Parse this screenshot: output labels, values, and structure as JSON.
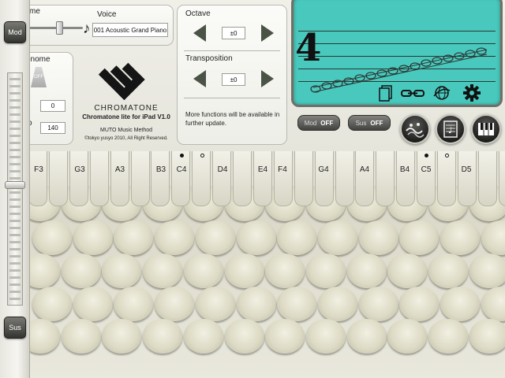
{
  "voice_panel": {
    "name_label": "me",
    "voice_label": "Voice",
    "voice_value": "001 Acoustic Grand Piano",
    "note_icon": "music-note-icon"
  },
  "metronome_panel": {
    "title": "onome",
    "switch_text": "OFF",
    "value1": "0",
    "value2": "140",
    "label_fragment": "o",
    "label_fragment2": ")"
  },
  "logo": {
    "brand": "CHROMATONE",
    "version_line": "Chromatone lite for iPad V1.0",
    "company": "MUTO Music Method",
    "copyright": "©tokyo yusyo 2010, All Right Reserved."
  },
  "octave_panel": {
    "octave_label": "Octave",
    "octave_value": "±0",
    "transposition_label": "Transposition",
    "transposition_value": "±0",
    "info_text": "More functions will be available in further update."
  },
  "lcd": {
    "digit": "4",
    "icons": [
      "pages-icon",
      "link-icon",
      "globe-icon",
      "gear-icon"
    ]
  },
  "toggles": {
    "mod_label": "Mod",
    "mod_state": "OFF",
    "sus_label": "Sus",
    "sus_state": "OFF"
  },
  "round_buttons": [
    "wave-icon",
    "score-icon",
    "keyboard-icon"
  ],
  "sidebar": {
    "mod_button": "Mod",
    "sus_button": "Sus"
  },
  "notes": [
    "F3",
    "G3",
    "A3",
    "B3",
    "C4",
    "D4",
    "E4",
    "F4",
    "G4",
    "A4",
    "B4",
    "C5",
    "D5"
  ],
  "colors": {
    "lcd": "#49c9bd",
    "key": "#dddbc5",
    "button_dark": "#333330"
  }
}
